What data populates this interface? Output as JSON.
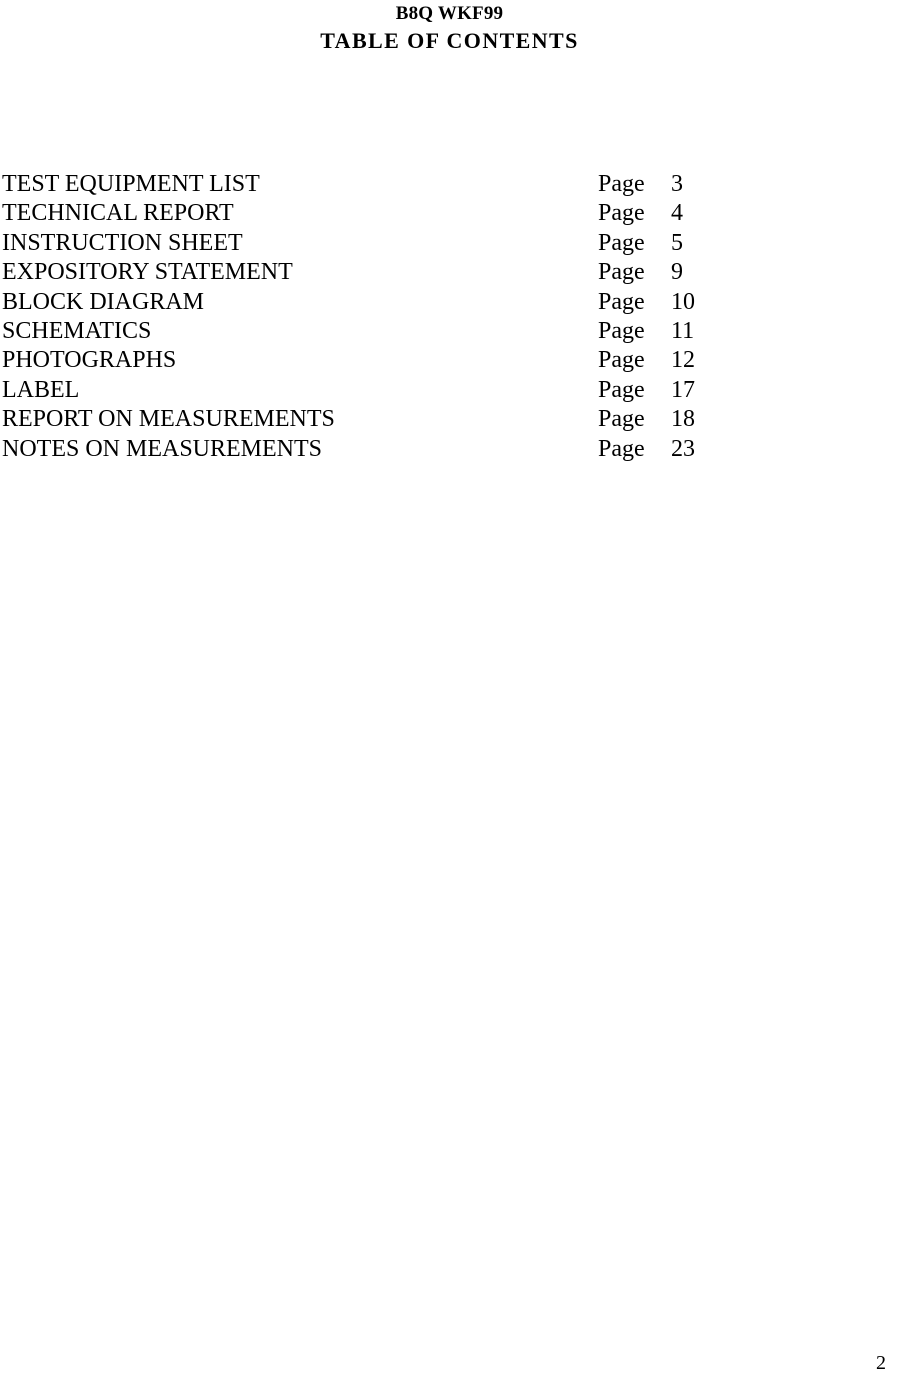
{
  "document": {
    "header": {
      "code": "B8Q WKF99",
      "title": "TABLE  OF  CONTENTS"
    },
    "contents": {
      "page_label": "Page",
      "entries": [
        {
          "title": "TEST EQUIPMENT LIST",
          "page_label": "Page",
          "page": "3"
        },
        {
          "title": "TECHNICAL REPORT",
          "page_label": "Page",
          "page": "4"
        },
        {
          "title": "INSTRUCTION SHEET",
          "page_label": "Page",
          "page": "5"
        },
        {
          "title": "EXPOSITORY STATEMENT",
          "page_label": "Page",
          "page": "9"
        },
        {
          "title": "BLOCK DIAGRAM",
          "page_label": "Page",
          "page": "10"
        },
        {
          "title": "SCHEMATICS",
          "page_label": "Page",
          "page": "11"
        },
        {
          "title": "PHOTOGRAPHS",
          "page_label": "Page",
          "page": "12"
        },
        {
          "title": "LABEL",
          "page_label": "Page",
          "page": "17"
        },
        {
          "title": "REPORT ON MEASUREMENTS",
          "page_label": "Page",
          "page": "18"
        },
        {
          "title": "NOTES ON MEASUREMENTS",
          "page_label": "Page",
          "page": "23"
        }
      ]
    },
    "footer": {
      "page_number": "2"
    }
  }
}
